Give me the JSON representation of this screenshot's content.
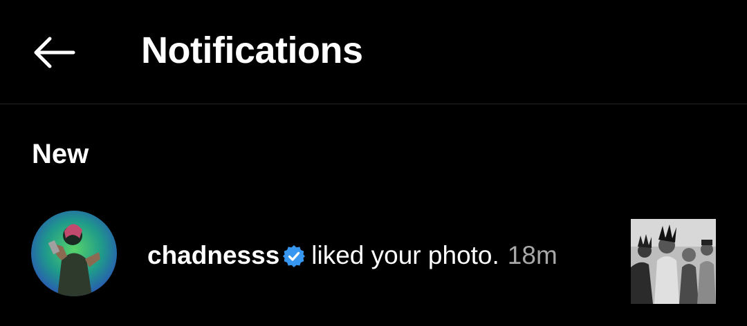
{
  "header": {
    "title": "Notifications",
    "back_icon": "arrow-left-icon"
  },
  "sections": [
    {
      "heading": "New",
      "items": [
        {
          "username": "chadnesss",
          "verified": true,
          "verified_icon": "verified-badge-icon",
          "action": "liked your photo.",
          "time": "18m"
        }
      ]
    }
  ],
  "colors": {
    "background": "#000000",
    "text": "#ffffff",
    "secondary_text": "#a8a8a8",
    "verified": "#3797f0",
    "divider": "#262626"
  }
}
